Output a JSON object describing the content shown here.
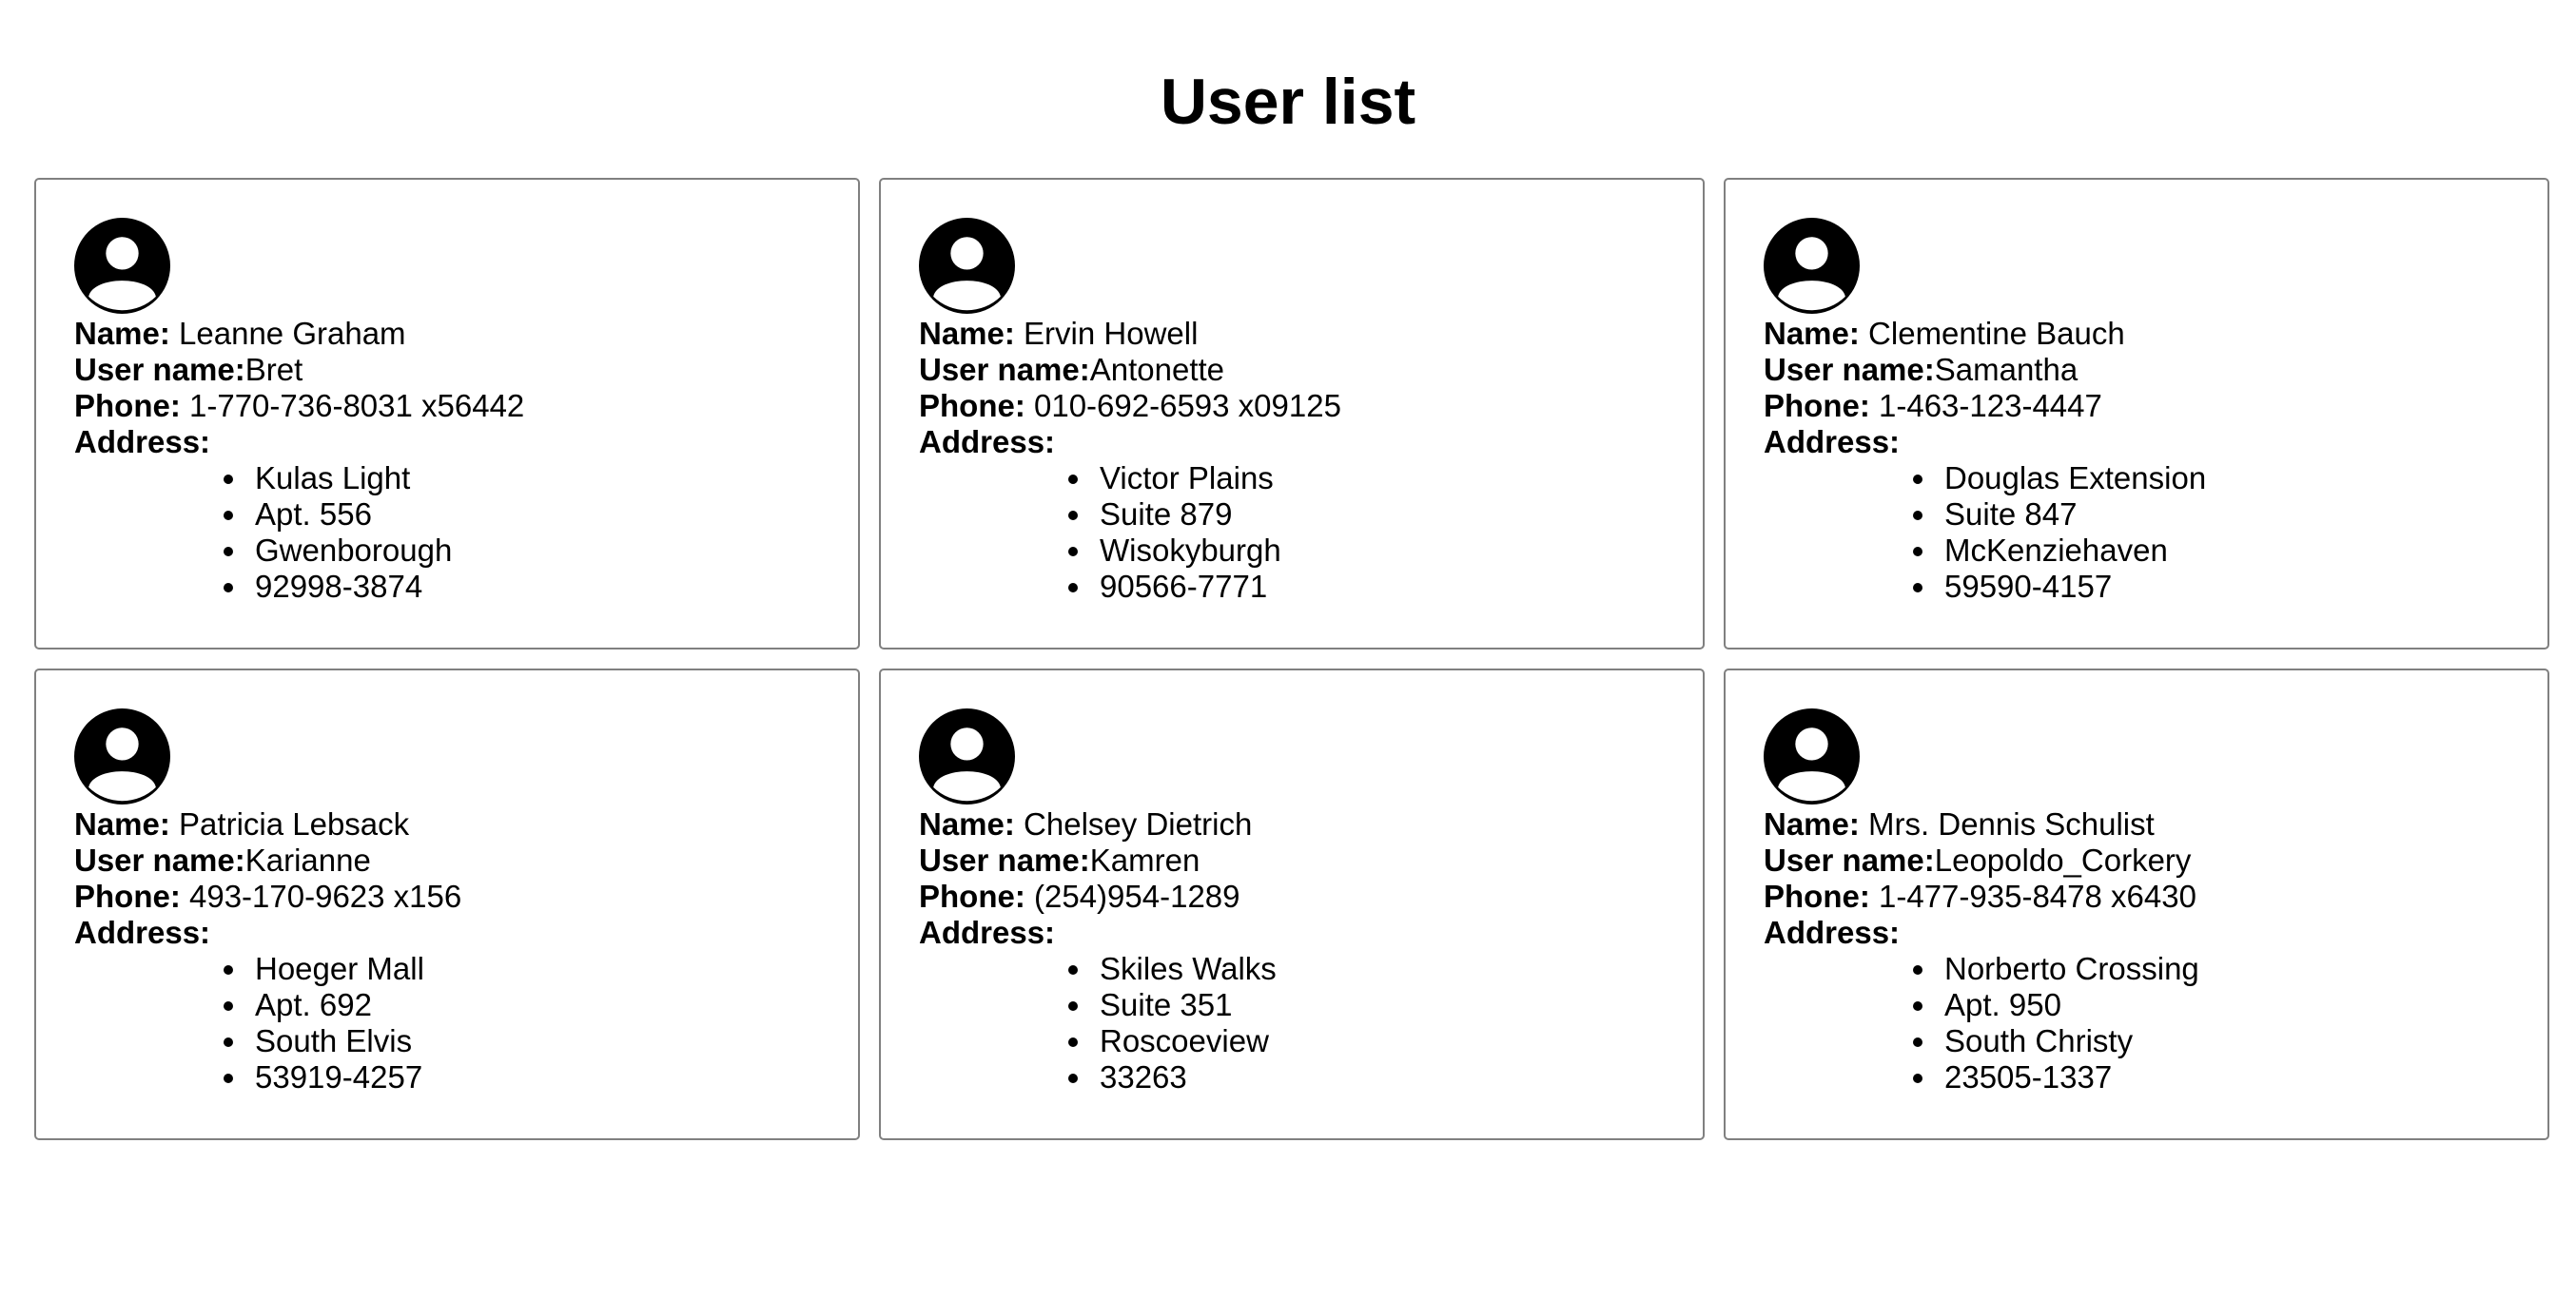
{
  "page": {
    "title": "User list"
  },
  "labels": {
    "name": "Name:",
    "username": "User name:",
    "phone": "Phone:",
    "address": "Address:"
  },
  "users": [
    {
      "name": "Leanne Graham",
      "username": "Bret",
      "phone": "1-770-736-8031 x56442",
      "address": [
        "Kulas Light",
        "Apt. 556",
        "Gwenborough",
        "92998-3874"
      ]
    },
    {
      "name": "Ervin Howell",
      "username": "Antonette",
      "phone": "010-692-6593 x09125",
      "address": [
        "Victor Plains",
        "Suite 879",
        "Wisokyburgh",
        "90566-7771"
      ]
    },
    {
      "name": "Clementine Bauch",
      "username": "Samantha",
      "phone": "1-463-123-4447",
      "address": [
        "Douglas Extension",
        "Suite 847",
        "McKenziehaven",
        "59590-4157"
      ]
    },
    {
      "name": "Patricia Lebsack",
      "username": "Karianne",
      "phone": "493-170-9623 x156",
      "address": [
        "Hoeger Mall",
        "Apt. 692",
        "South Elvis",
        "53919-4257"
      ]
    },
    {
      "name": "Chelsey Dietrich",
      "username": "Kamren",
      "phone": "(254)954-1289",
      "address": [
        "Skiles Walks",
        "Suite 351",
        "Roscoeview",
        "33263"
      ]
    },
    {
      "name": "Mrs. Dennis Schulist",
      "username": "Leopoldo_Corkery",
      "phone": "1-477-935-8478 x6430",
      "address": [
        "Norberto Crossing",
        "Apt. 950",
        "South Christy",
        "23505-1337"
      ]
    }
  ],
  "icons": {
    "avatar": "user-avatar-icon"
  },
  "colors": {
    "text": "#000000",
    "card_border": "#808080",
    "background": "#ffffff"
  }
}
